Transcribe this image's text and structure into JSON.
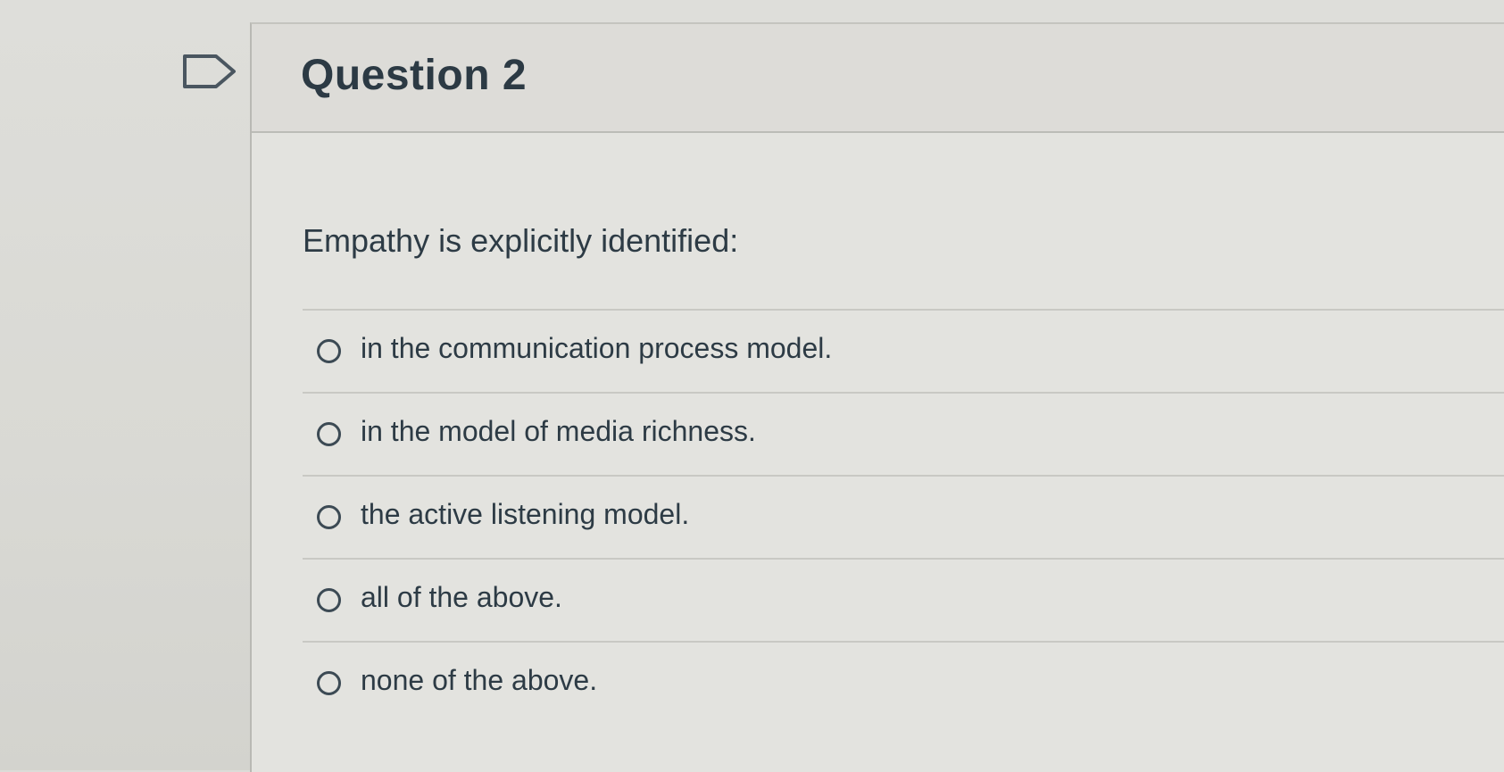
{
  "question": {
    "title": "Question 2",
    "prompt": "Empathy is explicitly identified:",
    "answers": [
      {
        "label": "in the communication process model.",
        "selected": false
      },
      {
        "label": "in the model of media richness.",
        "selected": false
      },
      {
        "label": "the active listening model.",
        "selected": false
      },
      {
        "label": "all of the above.",
        "selected": false
      },
      {
        "label": "none of the above.",
        "selected": false
      }
    ]
  },
  "icons": {
    "flag": "flag-bookmark-icon"
  },
  "colors": {
    "text": "#2d3b45",
    "background": "#e3e3df",
    "divider": "#c9c9c4"
  }
}
